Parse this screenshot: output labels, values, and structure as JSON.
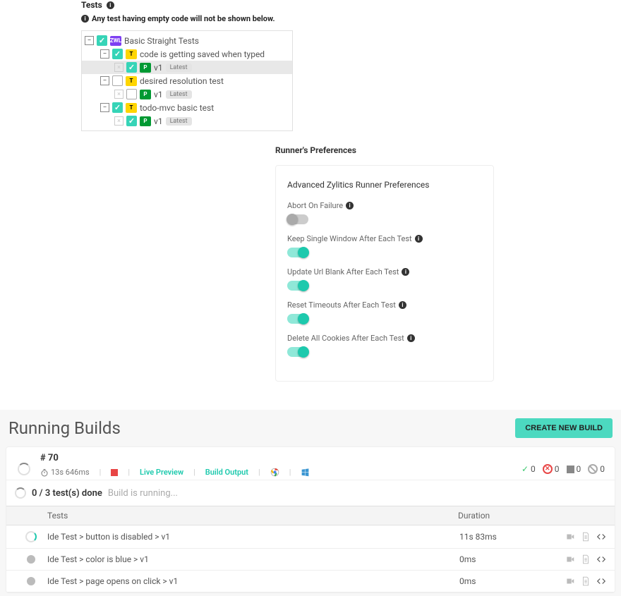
{
  "tests_panel": {
    "title": "Tests",
    "note": "Any test having empty code will not be shown below.",
    "root_label": "Basic Straight Tests",
    "root_tag": "ZWL",
    "items": [
      {
        "label": "code is getting saved when typed",
        "checked": true,
        "version": "v1",
        "badge": "Latest",
        "highlight": true
      },
      {
        "label": "desired resolution test",
        "checked": false,
        "version": "v1",
        "badge": "Latest",
        "highlight": false
      },
      {
        "label": "todo-mvc basic test",
        "checked": true,
        "version": "v1",
        "badge": "Latest",
        "highlight": false
      }
    ]
  },
  "prefs": {
    "title": "Runner's Preferences",
    "subtitle": "Advanced Zylitics Runner Preferences",
    "options": [
      {
        "label": "Abort On Failure",
        "on": false
      },
      {
        "label": "Keep Single Window After Each Test",
        "on": true
      },
      {
        "label": "Update Url Blank After Each Test",
        "on": true
      },
      {
        "label": "Reset Timeouts After Each Test",
        "on": true
      },
      {
        "label": "Delete All Cookies After Each Test",
        "on": true
      }
    ]
  },
  "builds": {
    "title": "Running Builds",
    "new_build_btn": "CREATE NEW BUILD",
    "build_number": "# 70",
    "elapsed": "13s 646ms",
    "live_preview_label": "Live Preview",
    "build_output_label": "Build Output",
    "counts": {
      "pass": "0",
      "fail": "0",
      "skip": "0",
      "abort": "0"
    },
    "done_label": "0 / 3 test(s) done",
    "running_label": "Build is running...",
    "columns": {
      "tests": "Tests",
      "duration": "Duration"
    },
    "rows": [
      {
        "name": "Ide Test > button is disabled > v1",
        "duration": "11s 83ms",
        "status": "running"
      },
      {
        "name": "Ide Test > color is blue > v1",
        "duration": "0ms",
        "status": "pending"
      },
      {
        "name": "Ide Test > page opens on click > v1",
        "duration": "0ms",
        "status": "pending"
      }
    ]
  }
}
